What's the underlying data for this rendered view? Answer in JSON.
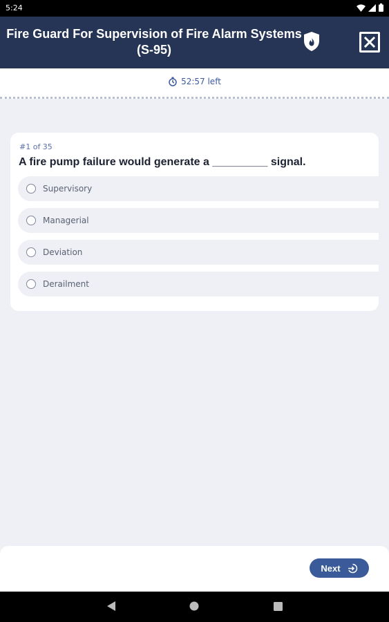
{
  "status_bar": {
    "time": "5:24"
  },
  "header": {
    "title": "Fire Guard For Supervision of Fire Alarm Systems (S-95)"
  },
  "timer": {
    "text": "52:57 left"
  },
  "question": {
    "counter": "#1 of 35",
    "text": "A fire pump failure would generate a _________ signal.",
    "options": [
      {
        "label": "Supervisory"
      },
      {
        "label": "Managerial"
      },
      {
        "label": "Deviation"
      },
      {
        "label": "Derailment"
      }
    ]
  },
  "footer": {
    "next_label": "Next"
  },
  "colors": {
    "header": "#263556",
    "accent": "#3a5a9a",
    "background": "#eef0f5"
  }
}
